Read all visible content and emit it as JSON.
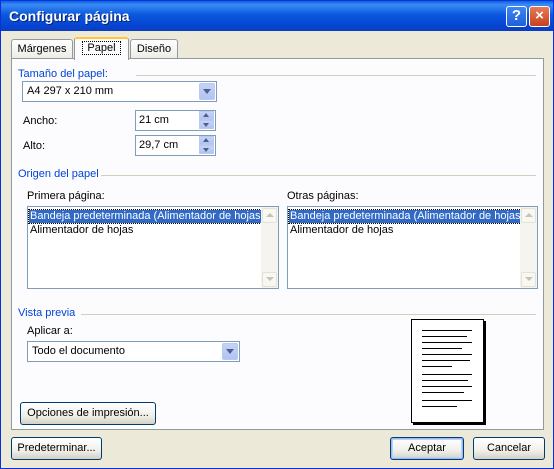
{
  "window": {
    "title": "Configurar página"
  },
  "title_buttons": {
    "help": "?",
    "close": "×"
  },
  "tabs": [
    {
      "label": "Márgenes",
      "active": false
    },
    {
      "label": "Papel",
      "active": true
    },
    {
      "label": "Diseño",
      "active": false
    }
  ],
  "paper_size": {
    "group_title": "Tamaño del papel:",
    "selected": "A4 297 x 210 mm",
    "width_label": "Ancho:",
    "width_value": "21 cm",
    "height_label": "Alto:",
    "height_value": "29,7 cm"
  },
  "paper_source": {
    "group_title": "Origen del papel",
    "first_page_label": "Primera página:",
    "other_pages_label": "Otras páginas:",
    "first_page_items": [
      "Bandeja predeterminada (Alimentador de hojas)",
      "Alimentador de hojas"
    ],
    "other_pages_items": [
      "Bandeja predeterminada (Alimentador de hojas)",
      "Alimentador de hojas"
    ]
  },
  "preview": {
    "group_title": "Vista previa",
    "apply_label": "Aplicar a:",
    "apply_value": "Todo el documento"
  },
  "buttons": {
    "print_options": "Opciones de impresión...",
    "default": "Predeterminar...",
    "ok": "Aceptar",
    "cancel": "Cancelar"
  }
}
